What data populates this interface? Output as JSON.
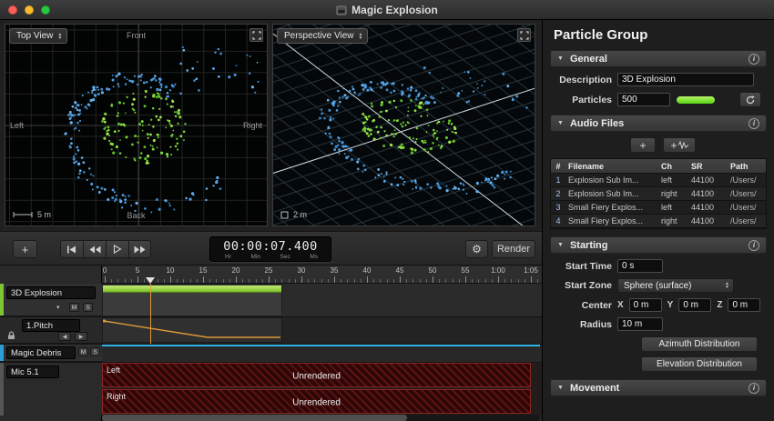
{
  "icons": {
    "disclosure": "▼",
    "info": "i",
    "plus": "+",
    "gear": "⚙",
    "caret_down": "▾",
    "prev": "◀",
    "next": "▶"
  },
  "titlebar": {
    "title": "Magic Explosion"
  },
  "viewports": {
    "left": {
      "selector": "Top View",
      "front": "Front",
      "left": "Left",
      "right": "Right",
      "back": "Back",
      "scale": "5 m"
    },
    "right": {
      "selector": "Perspective View",
      "scale": "2 m"
    }
  },
  "transport": {
    "time": "00:00:07.400",
    "units": [
      "Hr",
      "Min",
      "Sec",
      "Ms"
    ],
    "render": "Render"
  },
  "timeline": {
    "ruler": [
      "0",
      "5",
      "10",
      "15",
      "20",
      "25",
      "30",
      "35",
      "40",
      "45",
      "50",
      "55",
      "1:00",
      "1:05"
    ],
    "tracks": {
      "explosion": {
        "name": "3D Explosion",
        "mute": "M",
        "solo": "S"
      },
      "pitch": {
        "name": "1.Pitch"
      },
      "debris": {
        "name": "Magic Debris",
        "mute": "M",
        "solo": "S"
      },
      "mic": {
        "name": "Mic 5.1",
        "channels": [
          "Left",
          "Right"
        ],
        "unrendered": "Unrendered"
      }
    }
  },
  "inspector": {
    "title": "Particle Group",
    "general": {
      "title": "General",
      "description_label": "Description",
      "description_value": "3D Explosion",
      "particles_label": "Particles",
      "particles_value": "500",
      "particle_color": "#55d40e"
    },
    "audio_files": {
      "title": "Audio Files",
      "columns": [
        "#",
        "Filename",
        "Ch",
        "SR",
        "Path"
      ],
      "rows": [
        [
          "1",
          "Explosion Sub Im...",
          "left",
          "44100",
          "/Users/"
        ],
        [
          "2",
          "Explosion Sub Im...",
          "right",
          "44100",
          "/Users/"
        ],
        [
          "3",
          "Small Fiery Explos...",
          "left",
          "44100",
          "/Users/"
        ],
        [
          "4",
          "Small Fiery Explos...",
          "right",
          "44100",
          "/Users/"
        ]
      ]
    },
    "starting": {
      "title": "Starting",
      "start_time_label": "Start Time",
      "start_time_value": "0 s",
      "start_zone_label": "Start Zone",
      "start_zone_value": "Sphere (surface)",
      "center_label": "Center",
      "axis_x": "X",
      "axis_y": "Y",
      "axis_z": "Z",
      "center_x_value": "0 m",
      "center_y_value": "0 m",
      "center_z_value": "0 m",
      "radius_label": "Radius",
      "radius_value": "10 m",
      "azimuth_button": "Azimuth Distribution",
      "elevation_button": "Elevation Distribution"
    },
    "movement": {
      "title": "Movement"
    }
  },
  "scene": {
    "green_palette": [
      "#7edd3a",
      "#a2e651",
      "#5fc12b"
    ],
    "blue_palette": [
      "#4d9de3",
      "#66b1ef",
      "#3e86c4"
    ]
  }
}
